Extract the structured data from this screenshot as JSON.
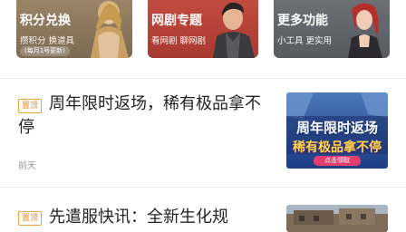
{
  "tiles": [
    {
      "title": "积分兑换",
      "subtitle": "攒积分  换道具",
      "chip": "(每月1号更新)",
      "bg": "#8c765c"
    },
    {
      "title": "网剧专题",
      "subtitle": "看网剧  聊网剧",
      "bg": "#b8453a"
    },
    {
      "title": "更多功能",
      "subtitle": "小工具  更实用",
      "bg": "#63666c"
    }
  ],
  "articles": [
    {
      "badge": "置顶",
      "title": "周年限时返场，稀有极品拿不停",
      "time": "前天",
      "thumb": {
        "line1": "周年限时返场",
        "line2": "稀有极品拿不停",
        "button": "点击领取"
      }
    },
    {
      "badge": "置顶",
      "title": "先遣服快讯：全新生化规"
    }
  ],
  "colors": {
    "accent": "#e0902a",
    "text": "#222222",
    "muted": "#9a9a9a"
  }
}
